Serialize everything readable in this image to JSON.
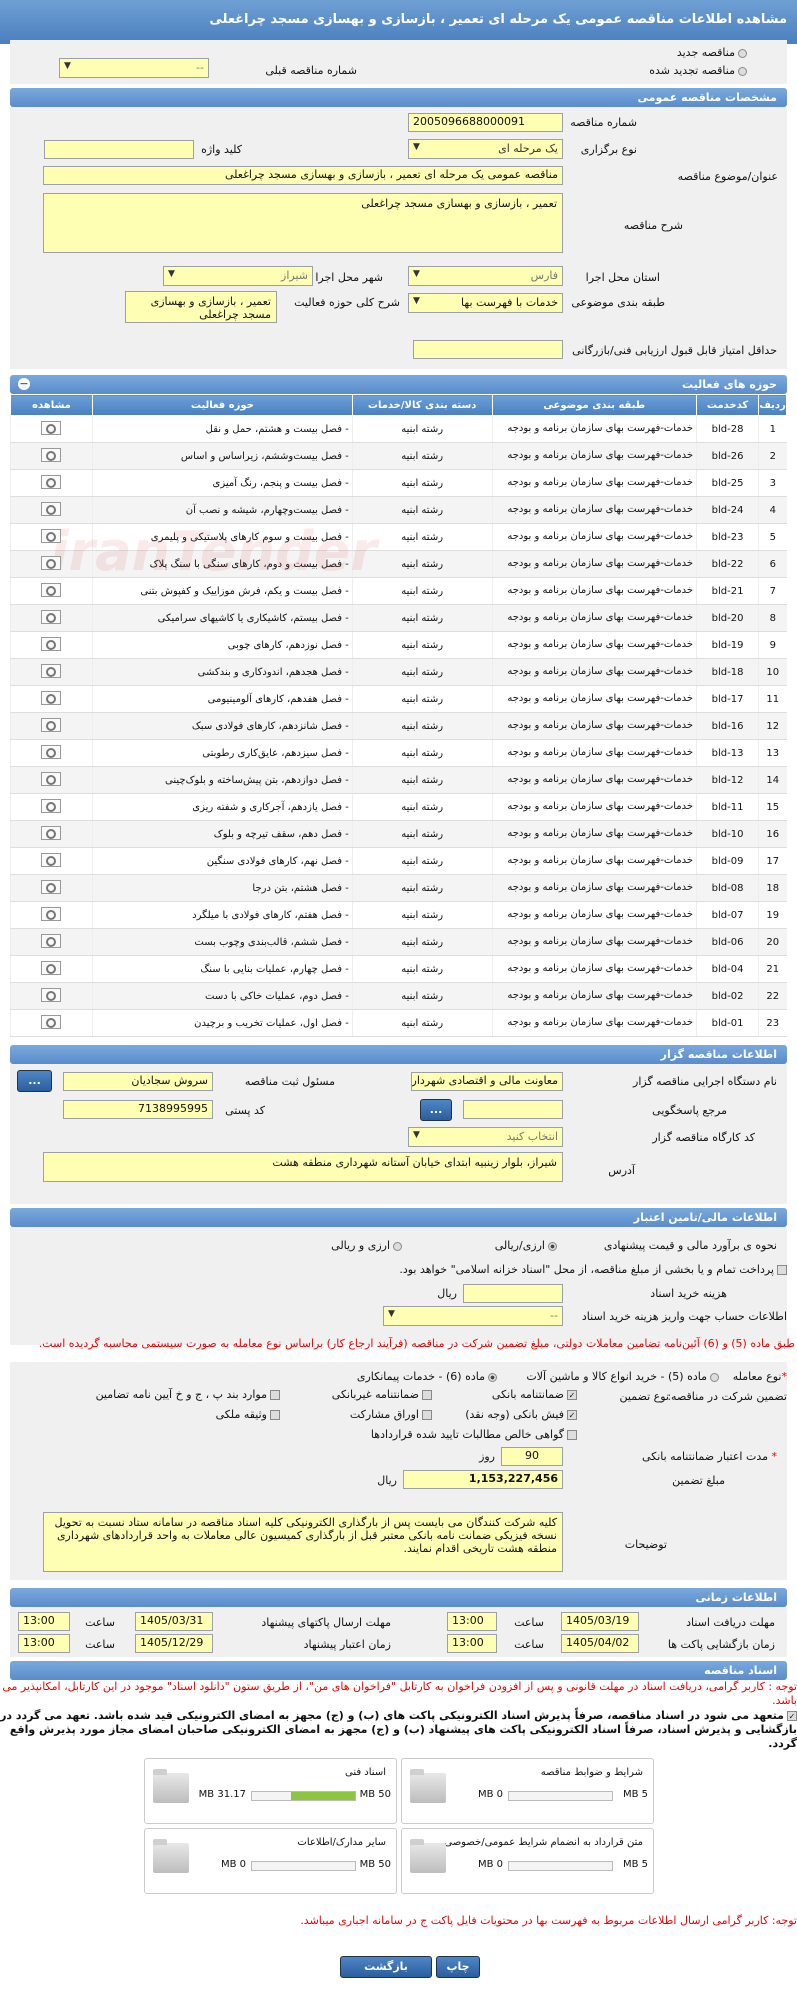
{
  "title": "مشاهده اطلاعات مناقصه عمومی یک مرحله ای تعمیر ، بازسازی و بهسازی مسجد چراغعلی",
  "top": {
    "new_tender": "مناقصه جدید",
    "renewed_tender": "مناقصه تجدید شده",
    "prev_tender_label": "شماره مناقصه قبلی",
    "prev_tender_value": "--"
  },
  "general": {
    "header": "مشخصات مناقصه عمومی",
    "number_label": "شماره مناقصه",
    "number_value": "2005096688000091",
    "type_label": "نوع برگزاری",
    "type_value": "یک مرحله ای",
    "keyword_label": "کلید واژه",
    "subject_label": "عنوان/موضوع مناقصه",
    "subject_value": "مناقصه عمومی یک مرحله ای تعمیر ، بازسازی و بهسازی مسجد چراغعلی",
    "desc_label": "شرح مناقصه",
    "desc_value": "تعمیر ، بازسازی و بهسازی مسجد چراغعلی",
    "province_label": "استان محل اجرا",
    "province_value": "فارس",
    "city_label": "شهر محل اجرا",
    "city_value": "شیراز",
    "category_label": "طبقه بندی موضوعی",
    "category_value": "خدمات با فهرست بها",
    "scope_label": "شرح کلی حوزه فعالیت",
    "scope_value": "تعمیر ، بازسازی و بهسازی مسجد چراغعلی",
    "min_score_label": "حداقل امتیاز قابل قبول ارزیابی فنی/بازرگانی"
  },
  "activities": {
    "header": "حوزه های فعالیت",
    "columns": [
      "ردیف",
      "کدخدمت",
      "طبقه بندی موضوعی",
      "دسته بندی کالا/خدمات",
      "حوزه فعالیت",
      "مشاهده"
    ],
    "category_text": "خدمات-فهرست بهای سازمان برنامه و بودجه",
    "group_text": "رشته ابنیه",
    "rows": [
      {
        "n": "1",
        "code": "bld-28",
        "act": "- فصل بیست و هشتم، حمل و نقل"
      },
      {
        "n": "2",
        "code": "bld-26",
        "act": "- فصل بیست‌وششم، زیراساس و اساس"
      },
      {
        "n": "3",
        "code": "bld-25",
        "act": "- فصل بیست و پنجم، رنگ آمیزی"
      },
      {
        "n": "4",
        "code": "bld-24",
        "act": "- فصل بیست‌وچهارم، شیشه و نصب آن"
      },
      {
        "n": "5",
        "code": "bld-23",
        "act": "- فصل بیست و سوم کارهای پلاستیکی و پلیمری"
      },
      {
        "n": "6",
        "code": "bld-22",
        "act": "- فصل بیست و دوم، کارهای سنگی با سنگ پلاک"
      },
      {
        "n": "7",
        "code": "bld-21",
        "act": "- فصل بیست و یکم، فرش موزاییک و کفپوش بتنی"
      },
      {
        "n": "8",
        "code": "bld-20",
        "act": "- فصل بیستم، کاشیکاری یا کاشیهای سرامیکی"
      },
      {
        "n": "9",
        "code": "bld-19",
        "act": "- فصل نوزدهم، کارهای چوبی"
      },
      {
        "n": "10",
        "code": "bld-18",
        "act": "- فصل هجدهم، اندودکاری و بندکشی"
      },
      {
        "n": "11",
        "code": "bld-17",
        "act": "- فصل هفدهم، کارهای آلومینیومی"
      },
      {
        "n": "12",
        "code": "bld-16",
        "act": "- فصل شانزدهم، کارهای فولادی سبک"
      },
      {
        "n": "13",
        "code": "bld-13",
        "act": "- فصل سیزدهم، عایق‌کاری رطوبتی"
      },
      {
        "n": "14",
        "code": "bld-12",
        "act": "- فصل دوازدهم، بتن پیش‌ساخته و بلوک‌چینی"
      },
      {
        "n": "15",
        "code": "bld-11",
        "act": "- فصل یازدهم، آجرکاری و شفته ریزی"
      },
      {
        "n": "16",
        "code": "bld-10",
        "act": "- فصل دهم، سقف تیرچه و بلوک"
      },
      {
        "n": "17",
        "code": "bld-09",
        "act": "- فصل نهم، کارهای فولادی سنگین"
      },
      {
        "n": "18",
        "code": "bld-08",
        "act": "- فصل هشتم، بتن درجا"
      },
      {
        "n": "19",
        "code": "bld-07",
        "act": "- فصل هفتم، کارهای فولادی با میلگرد"
      },
      {
        "n": "20",
        "code": "bld-06",
        "act": "- فصل ششم، قالب‌بندی وچوب بست"
      },
      {
        "n": "21",
        "code": "bld-04",
        "act": "- فصل چهارم، عملیات بنایی با سنگ"
      },
      {
        "n": "22",
        "code": "bld-02",
        "act": "- فصل دوم، عملیات خاکی با دست"
      },
      {
        "n": "23",
        "code": "bld-01",
        "act": "- فصل اول، عملیات تخریب و برچیدن"
      }
    ]
  },
  "organizer": {
    "header": "اطلاعات مناقصه گزار",
    "org_label": "نام دستگاه اجرایی مناقصه گزار",
    "org_value": "معاونت مالی و اقتصادی شهرداری شیراز",
    "registrar_label": "مسئول ثبت مناقصه",
    "registrar_value": "سروش سجادیان",
    "ref_label": "مرجع پاسخگویی",
    "postal_label": "کد پستی",
    "postal_value": "7138995995",
    "workshop_label": "کد کارگاه مناقصه گزار",
    "workshop_value": "انتخاب کنید",
    "address_label": "آدرس",
    "address_value": "شیراز، بلوار زینبیه ابتدای خیابان آستانه شهرداری منطقه هشت",
    "btn_dots": "..."
  },
  "finance": {
    "header": "اطلاعات مالی/تامین اعتبار",
    "estimate_label": "نحوه ی برآورد مالی و قیمت پیشنهادی",
    "rial": "ارزی/ریالی",
    "fx_rial": "ارزی و ریالی",
    "treasury_text": "پرداخت تمام و یا بخشی از مبلغ مناقصه، از محل \"اسناد خزانه اسلامی\" خواهد بود.",
    "doc_cost_label": "هزینه خرید اسناد",
    "doc_cost_unit": "ریال",
    "account_label": "اطلاعات حساب جهت واریز هزینه خرید اسناد",
    "account_value": "--",
    "notice": "طبق ماده (5) و (6) آئین‌نامه تضامین معاملات دولتی، مبلغ تضمین شرکت در مناقصه (فرآیند ارجاع کار) براساس نوع معامله به صورت سیستمی محاسبه گردیده است.",
    "deal_type_label": "نوع معامله",
    "deal_opt1": "ماده (5) - خرید انواع کالا و ماشین آلات",
    "deal_opt2": "ماده (6) - خدمات پیمانکاری",
    "guarantee_label": "تضمین شرکت در مناقصه:",
    "guarantee_type_label": "نوع تضمین",
    "g1": "ضمانتنامه بانکی",
    "g2": "ضمانتنامه غیربانکی",
    "g3": "موارد بند پ ، ج و خ آیین نامه تضامین",
    "g4": "فیش بانکی (وجه نقد)",
    "g5": "اوراق مشارکت",
    "g6": "وثیقه ملکی",
    "g7": "گواهی خالص مطالبات تایید شده قراردادها",
    "validity_label": "مدت اعتبار ضمانتنامه بانکی",
    "validity_value": "90",
    "validity_unit": "روز",
    "amount_label": "مبلغ تضمین",
    "amount_value": "1,153,227,456",
    "amount_unit": "ریال",
    "explain_label": "توضیحات",
    "explain_value": "کلیه شرکت کنندگان می بایست پس از بارگذاری الکترونیکی کلیه اسناد مناقصه در سامانه ستاد نسبت به تحویل نسخه فیزیکی ضمانت نامه بانکی معتبر قبل از بارگذاری کمیسیون عالی معاملات به واحد قراردادهای شهرداری منطقه هشت تاریخی اقدام نمایند."
  },
  "schedule": {
    "header": "اطلاعات زمانی",
    "receive_label": "مهلت دریافت اسناد",
    "receive_date": "1405/03/19",
    "receive_time": "13:00",
    "send_label": "مهلت ارسال پاکتهای پیشنهاد",
    "send_date": "1405/03/31",
    "send_time": "13:00",
    "open_label": "زمان بازگشایی پاکت ها",
    "open_date": "1405/04/02",
    "open_time": "13:00",
    "valid_label": "زمان اعتبار پیشنهاد",
    "valid_date": "1405/12/29",
    "valid_time": "13:00",
    "time_word": "ساعت"
  },
  "documents": {
    "header": "اسناد مناقصه",
    "note1": "توجه : کاربر گرامی، دریافت اسناد در مهلت قانونی و پس از افزودن فراخوان به کارتابل \"فراخوان های من\"، از طریق ستون \"دانلود اسناد\" موجود در این کارتابل، امکانپذیر می باشد.",
    "commit": "متعهد می شود در اسناد مناقصه، صرفاً پذیرش اسناد الکترونیکی پاکت های (ب) و (ج) مجهز به امضای الکترونیکی قید شده باشد. تعهد می گردد در بازگشایی و پذیرش اسناد، صرفاً اسناد الکترونیکی پاکت های پیشنهاد (ب) و (ج) مجهز به امضای الکترونیکی صاحبان امضای مجاز مورد پذیرش واقع گردد.",
    "items": [
      {
        "name": "شرایط و ضوابط مناقصه",
        "cur": "0 MB",
        "max": "5 MB",
        "fill": 0
      },
      {
        "name": "اسناد فنی",
        "cur": "31.17 MB",
        "max": "50 MB",
        "fill": 0.62
      },
      {
        "name": "متن قرارداد به انضمام شرایط عمومی/خصوصی",
        "cur": "0 MB",
        "max": "5 MB",
        "fill": 0
      },
      {
        "name": "سایر مدارک/اطلاعات",
        "cur": "0 MB",
        "max": "50 MB",
        "fill": 0
      }
    ],
    "note2": "توجه: کاربر گرامی ارسال اطلاعات مربوط به فهرست بها در محتویات فایل پاکت ج در سامانه اجباری میباشد."
  },
  "footer": {
    "back": "بازگشت",
    "print": "چاپ"
  }
}
